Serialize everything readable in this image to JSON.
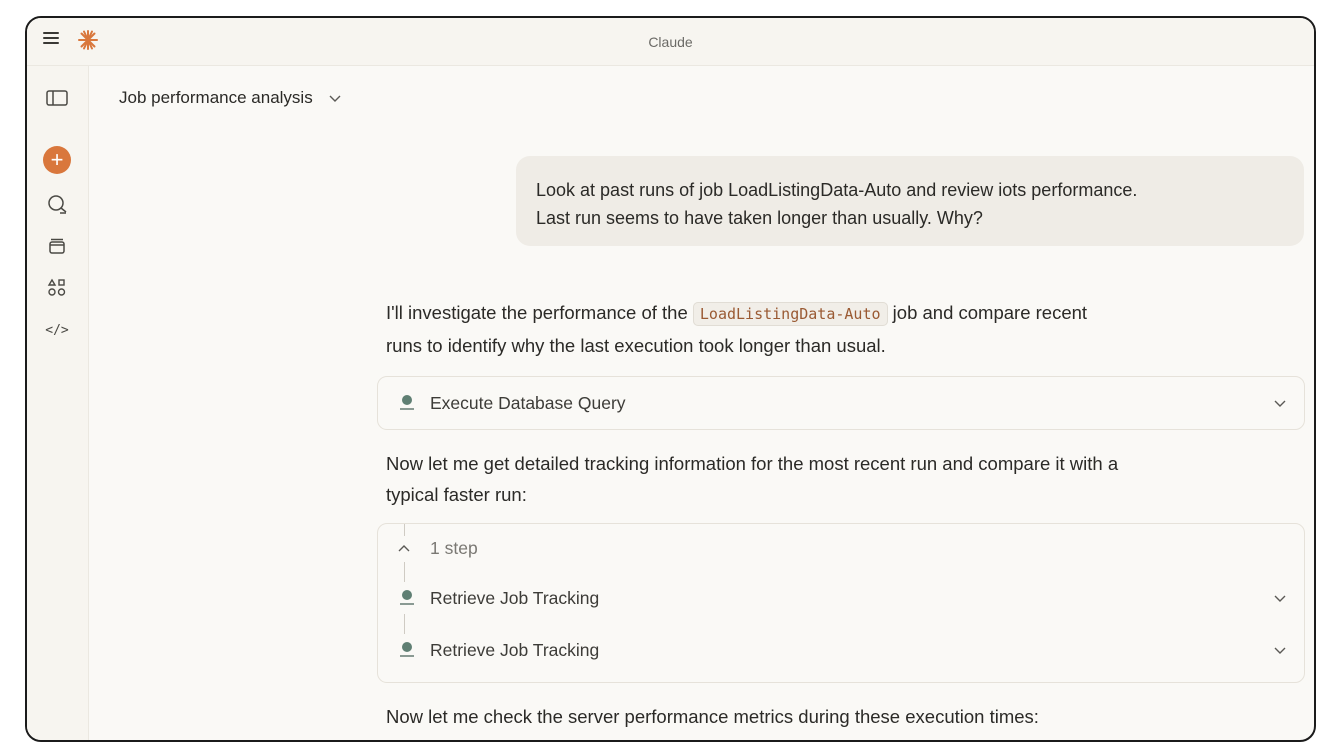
{
  "window": {
    "title": "Claude"
  },
  "icons": {
    "menu": "hamburger-icon",
    "logo": "claude-logo-icon",
    "sidebar_toggle": "sidebar-toggle-icon",
    "new_chat": "plus-icon",
    "chats": "chat-search-icon",
    "projects": "stack-icon",
    "artifacts": "shapes-icon",
    "code": "code-icon"
  },
  "colors": {
    "accent": "#d9773c",
    "background": "#faf9f6",
    "bubble": "#efece6"
  },
  "conversation": {
    "title": "Job performance analysis",
    "user_message": {
      "line1": "Look at past runs of job LoadListingData-Auto and review iots performance.",
      "line2": "Last run seems to have taken longer than usually. Why?"
    },
    "assistant": {
      "intro_pre": "I'll investigate the performance of the",
      "intro_code": "LoadListingData-Auto",
      "intro_post": "job and compare recent",
      "intro_line2": "runs to identify why the last execution took longer than usual.",
      "tool1": "Execute Database Query",
      "msg2_line1": "Now let me get detailed tracking information for the most recent run and compare it with a",
      "msg2_line2": "typical faster run:",
      "steps_label": "1 step",
      "tool2": "Retrieve Job Tracking",
      "tool3": "Retrieve Job Tracking",
      "msg3": "Now let me check the server performance metrics during these execution times:"
    }
  }
}
